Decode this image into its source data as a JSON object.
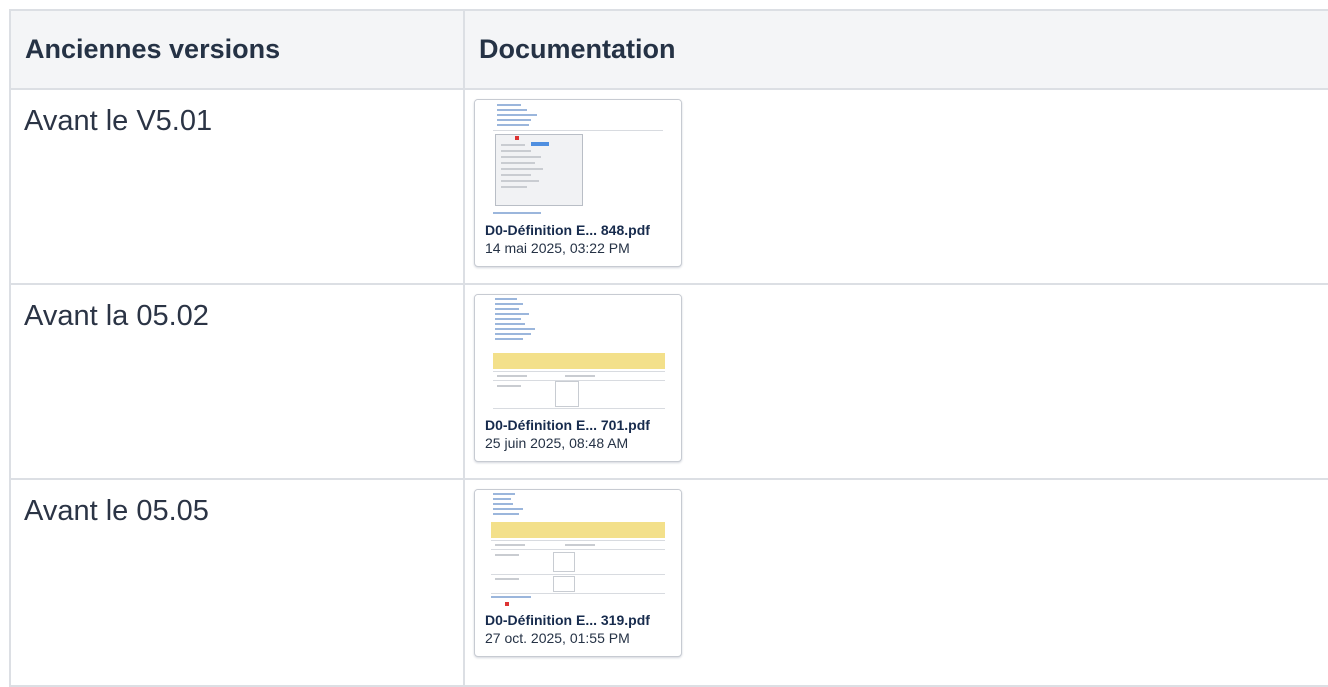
{
  "table": {
    "headers": [
      "Anciennes versions",
      "Documentation"
    ],
    "rows": [
      {
        "version": "Avant le V5.01",
        "file": {
          "name": "D0-Définition E... 848.pdf",
          "date": "14 mai 2025, 03:22 PM",
          "icon": "pdf-thumbnail"
        }
      },
      {
        "version": "Avant la 05.02",
        "file": {
          "name": "D0-Définition E... 701.pdf",
          "date": "25 juin 2025, 08:48 AM",
          "icon": "pdf-thumbnail"
        }
      },
      {
        "version": "Avant le 05.05",
        "file": {
          "name": "D0-Définition E... 319.pdf",
          "date": "27 oct. 2025, 01:55 PM",
          "icon": "pdf-thumbnail"
        }
      }
    ]
  },
  "colors": {
    "header_bg": "#f4f5f7",
    "border": "#dcdfe4",
    "highlight_yellow": "#f3e08a",
    "link_blue": "#9bb6dc"
  }
}
